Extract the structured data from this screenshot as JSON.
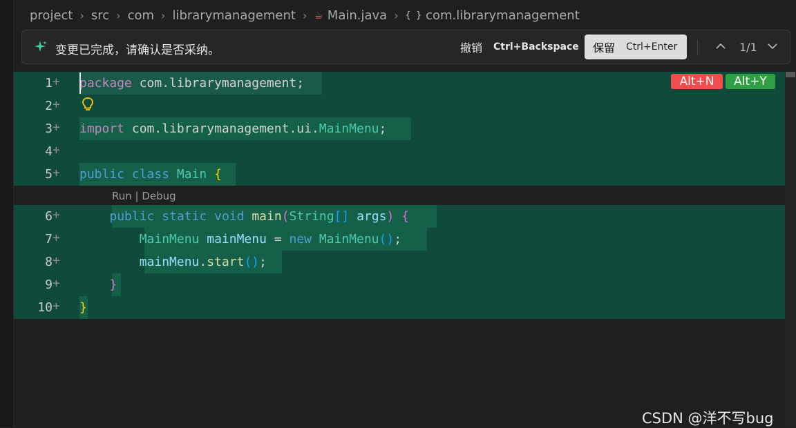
{
  "breadcrumb": {
    "items": [
      "project",
      "src",
      "com",
      "librarymanagement",
      "Main.java",
      "com.librarymanagement"
    ]
  },
  "review": {
    "message": "变更已完成，请确认是否采纳。",
    "undo_label": "撤销",
    "undo_shortcut": "Ctrl+Backspace",
    "keep_label": "保留",
    "keep_shortcut": "Ctrl+Enter",
    "counter": "1/1"
  },
  "badges": {
    "reject": "Alt+N",
    "accept": "Alt+Y"
  },
  "codelens": {
    "run": "Run",
    "sep": " | ",
    "debug": "Debug"
  },
  "gutter": {
    "line_numbers": [
      "1",
      "2",
      "3",
      "4",
      "5",
      "6",
      "7",
      "8",
      "9",
      "10"
    ],
    "plus": "+"
  },
  "code": {
    "l1": [
      "package",
      " com.librarymanagement;"
    ],
    "l3": [
      "import",
      " com.librarymanagement.ui.",
      "MainMenu",
      ";"
    ],
    "l5": [
      "public",
      " ",
      "class",
      " ",
      "Main",
      " ",
      "{"
    ],
    "l6": [
      "    ",
      "public",
      " ",
      "static",
      " ",
      "void",
      " ",
      "main",
      "(",
      "String",
      "[]",
      " ",
      "args",
      ")",
      " ",
      "{"
    ],
    "l7": [
      "        ",
      "MainMenu",
      " ",
      "mainMenu",
      " = ",
      "new",
      " ",
      "MainMenu",
      "()",
      ";"
    ],
    "l8": [
      "        ",
      "mainMenu",
      ".",
      "start",
      "()",
      ";"
    ],
    "l9": [
      "    ",
      "}"
    ],
    "l10": [
      "}"
    ]
  },
  "colors": {
    "added_line_bg": "#0f4a3a",
    "added_text_bg": "#156048",
    "accent_green": "#2ea043",
    "reject_red": "#f14c4c"
  },
  "watermark": "CSDN @洋不写bug"
}
